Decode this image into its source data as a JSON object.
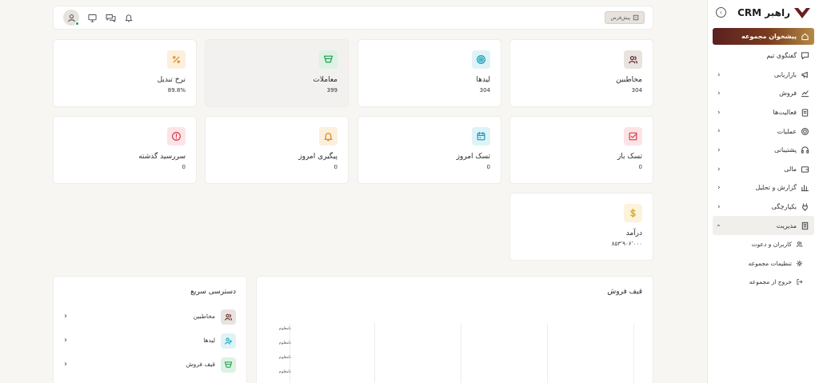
{
  "app": {
    "brand": "راهبر CRM"
  },
  "sidebar": {
    "items": [
      {
        "label": "پیشخوان مجموعه",
        "icon": "home-icon",
        "active": true
      },
      {
        "label": "گفتگوی تیم",
        "icon": "chat-icon"
      },
      {
        "label": "بازاریابی",
        "icon": "megaphone-icon",
        "chevron": true
      },
      {
        "label": "فروش",
        "icon": "chart-up-icon",
        "chevron": true
      },
      {
        "label": "فعالیت‌ها",
        "icon": "clipboard-icon",
        "chevron": true
      },
      {
        "label": "عملیات",
        "icon": "gear-icon",
        "chevron": true
      },
      {
        "label": "پشتیبانی",
        "icon": "headset-icon",
        "chevron": true
      },
      {
        "label": "مالی",
        "icon": "wallet-icon",
        "chevron": true
      },
      {
        "label": "گزارش و تحلیل",
        "icon": "bar-chart-icon",
        "chevron": true
      },
      {
        "label": "یکپارچگی",
        "icon": "plug-icon",
        "chevron": true
      },
      {
        "label": "مدیریت",
        "icon": "building-icon",
        "expanded": true
      },
      {
        "label": "کاربران و دعوت",
        "icon": "users-icon",
        "sub": true
      },
      {
        "label": "تنظیمات مجموعه",
        "icon": "settings-icon",
        "sub": true
      },
      {
        "label": "خروج از مجموعه",
        "icon": "logout-icon",
        "sub": true
      }
    ]
  },
  "topbar": {
    "org_button": "پیش‌فرض"
  },
  "cards": [
    {
      "title": "مخاطبین",
      "value": "304",
      "icon": "contacts-icon",
      "bg": "#e9e3df",
      "fg": "#5a2020"
    },
    {
      "title": "لیدها",
      "value": "304",
      "icon": "target-icon",
      "bg": "#dff3f7",
      "fg": "#0e9bb5"
    },
    {
      "title": "معاملات",
      "value": "399",
      "icon": "funnel-icon",
      "bg": "#dcf3e3",
      "fg": "#1e9a4b"
    },
    {
      "title": "نرخ تبدیل",
      "value": "89.8%",
      "icon": "percent-icon",
      "bg": "#fcefdc",
      "fg": "#d4871e"
    },
    {
      "title": "تسک باز",
      "value": "0",
      "icon": "check-square-icon",
      "bg": "#fce4e6",
      "fg": "#d9384a"
    },
    {
      "title": "تسک امروز",
      "value": "0",
      "icon": "calendar-icon",
      "bg": "#dff3f7",
      "fg": "#0e9bb5"
    },
    {
      "title": "پیگیری امروز",
      "value": "0",
      "icon": "bell-icon",
      "bg": "#fcefdc",
      "fg": "#d4871e"
    },
    {
      "title": "سررسید گذشته",
      "value": "0",
      "icon": "alert-circle-icon",
      "bg": "#fce4e6",
      "fg": "#d9384a"
    },
    {
      "title": "درآمد",
      "value": "۸۵۳٬۹۰۶٬۰۰۰",
      "icon": "dollar-icon",
      "bg": "#fcf3dc",
      "fg": "#d4a21e"
    }
  ],
  "quick_access": {
    "title": "دسترسی سریع",
    "items": [
      {
        "label": "مخاطبین",
        "icon": "contacts-icon",
        "bg": "#e9e3df",
        "fg": "#5a2020"
      },
      {
        "label": "لیدها",
        "icon": "user-plus-icon",
        "bg": "#dff3f7",
        "fg": "#0e9bb5"
      },
      {
        "label": "قیف فروش",
        "icon": "funnel-icon",
        "bg": "#dcf3e3",
        "fg": "#1e9a4b"
      }
    ]
  },
  "funnel": {
    "title": "قیف فروش",
    "y_labels": [
      "نامعلوم",
      "نامعلوم",
      "نامعلوم",
      "نامعلوم"
    ]
  }
}
